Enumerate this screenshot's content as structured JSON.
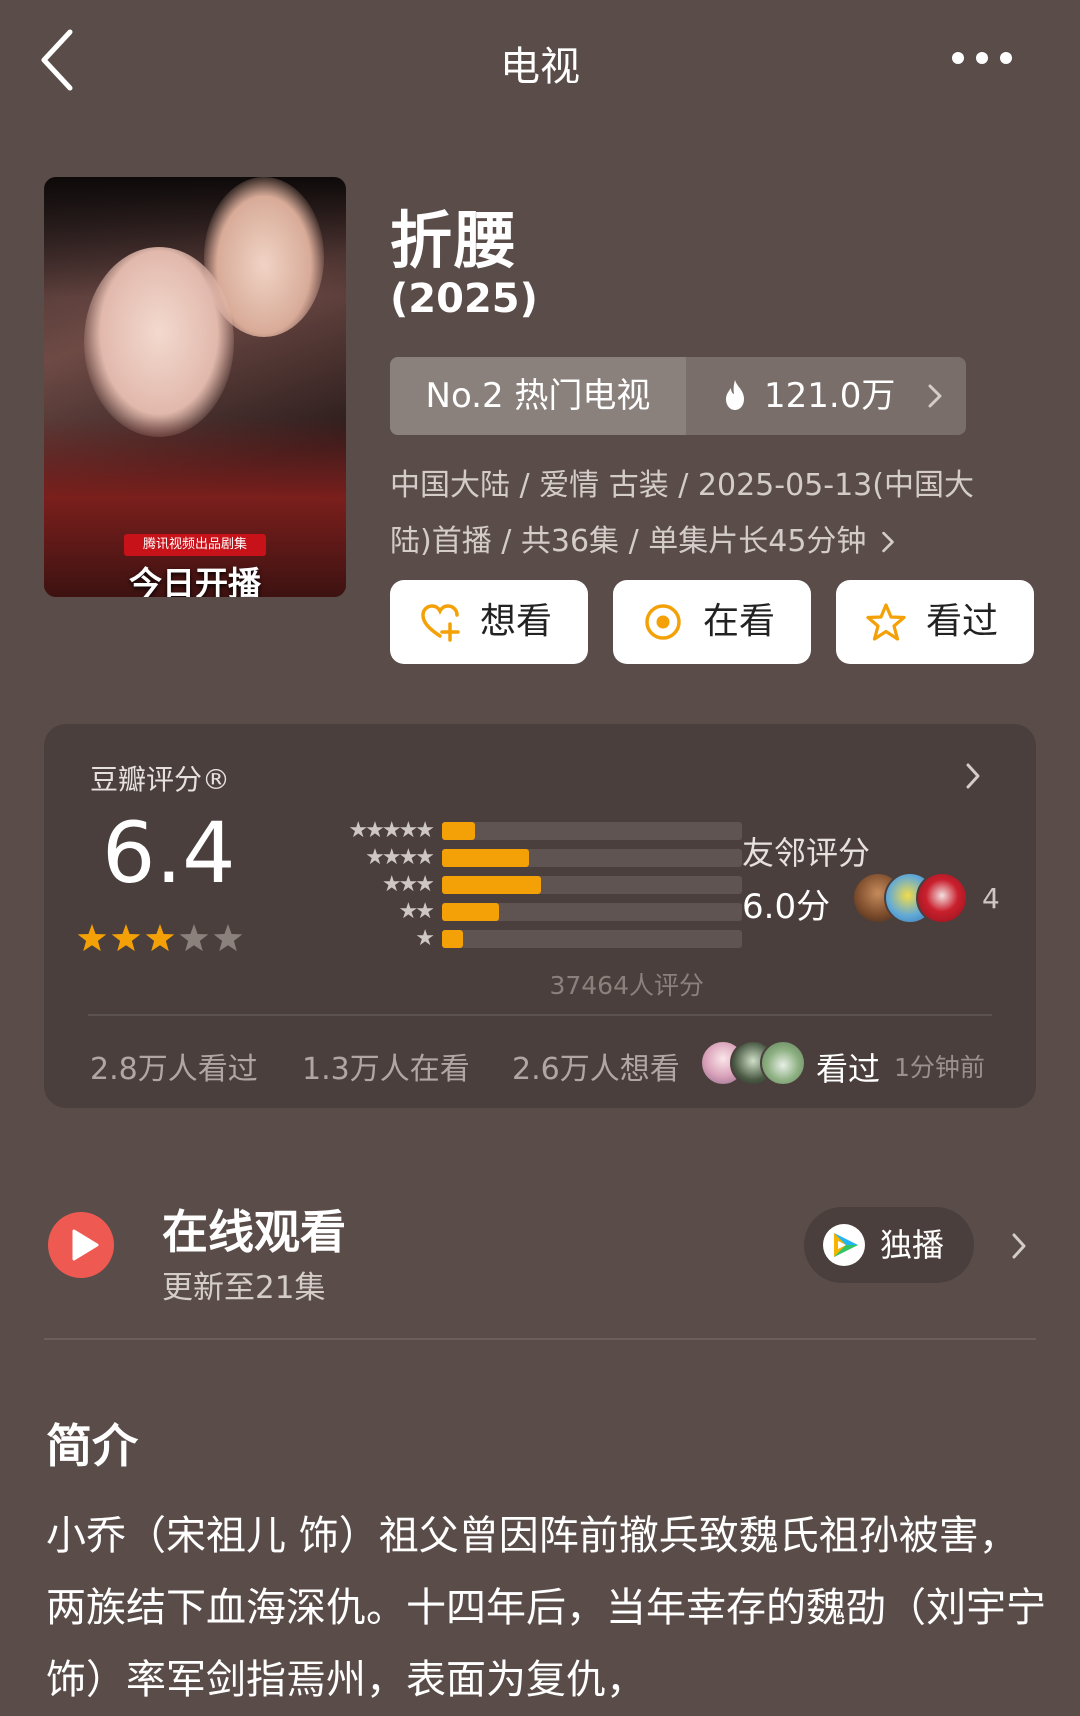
{
  "header": {
    "title": "电视"
  },
  "poster": {
    "subtitle": "腾讯视频出品剧集",
    "caption": "今日开播"
  },
  "show": {
    "title": "折腰",
    "year": "(2025)",
    "rank_label": "No.2 热门电视",
    "heat": "121.0万",
    "meta_line1": "中国大陆 / 爱情 古装 / 2025-05-13(中国大",
    "meta_line2": "陆)首播 / 共36集 / 单集片长45分钟"
  },
  "actions": {
    "want": "想看",
    "watching": "在看",
    "watched": "看过"
  },
  "rating": {
    "label": "豆瓣评分®",
    "score": "6.4",
    "stars_filled": 3,
    "histogram": [
      {
        "stars": "★★★★★",
        "fraction": 0.11
      },
      {
        "stars": "★★★★",
        "fraction": 0.29
      },
      {
        "stars": "★★★",
        "fraction": 0.33
      },
      {
        "stars": "★★",
        "fraction": 0.19
      },
      {
        "stars": "★",
        "fraction": 0.07
      }
    ],
    "count": "37464人评分",
    "neighbor_label": "友邻评分",
    "neighbor_score": "6.0分",
    "neighbor_count": "4",
    "watched_count": "2.8万人看过",
    "watching_count": "1.3万人在看",
    "want_count": "2.6万人想看",
    "friend_action": "看过",
    "friend_time": "1分钟前"
  },
  "watch": {
    "title": "在线观看",
    "subtitle": "更新至21集",
    "platform_label": "独播"
  },
  "intro": {
    "title": "简介",
    "text": "小乔（宋祖儿 饰）祖父曾因阵前撤兵致魏氏祖孙被害，两族结下血海深仇。十四年后，当年幸存的魏劭（刘宇宁 饰）率军剑指焉州，表面为复仇，"
  },
  "colors": {
    "background": "#5a4d49",
    "card": "#4a3f3c",
    "accent": "#f4a007",
    "play": "#ee5a52"
  }
}
